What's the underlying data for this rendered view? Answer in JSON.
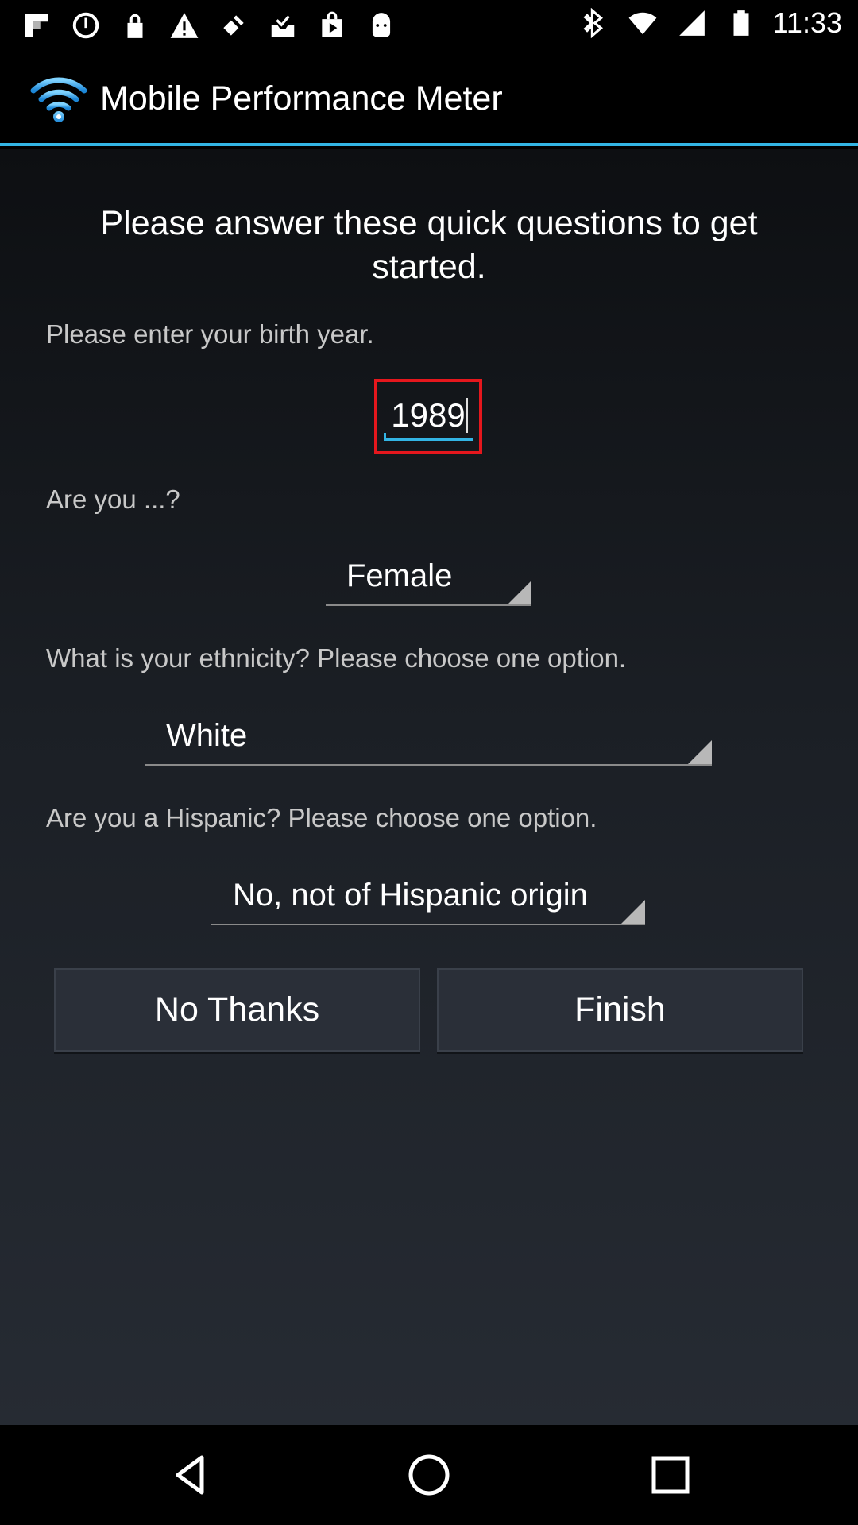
{
  "status_bar": {
    "time": "11:33",
    "left_icons": [
      "flipboard-icon",
      "sync-icon",
      "lock-icon",
      "warning-icon",
      "satellite-icon",
      "inbox-check-icon",
      "play-store-icon",
      "android-icon"
    ],
    "right_icons": [
      "bluetooth-icon",
      "wifi-icon",
      "signal-icon",
      "battery-icon"
    ]
  },
  "app_bar": {
    "title": "Mobile Performance Meter",
    "accent_color": "#33b5e5"
  },
  "form": {
    "heading": "Please answer these quick questions to get started.",
    "birth_year_label": "Please enter your birth year.",
    "birth_year_value": "1989",
    "gender_label": "Are you ...?",
    "gender_value": "Female",
    "ethnicity_label": "What is your ethnicity? Please choose one option.",
    "ethnicity_value": "White",
    "hispanic_label": "Are you a Hispanic? Please choose one option.",
    "hispanic_value": "No, not of Hispanic origin",
    "highlight_color": "#e5171d"
  },
  "buttons": {
    "no_thanks": "No Thanks",
    "finish": "Finish"
  },
  "nav_bar": {
    "icons": [
      "back-icon",
      "home-icon",
      "recents-icon"
    ]
  }
}
